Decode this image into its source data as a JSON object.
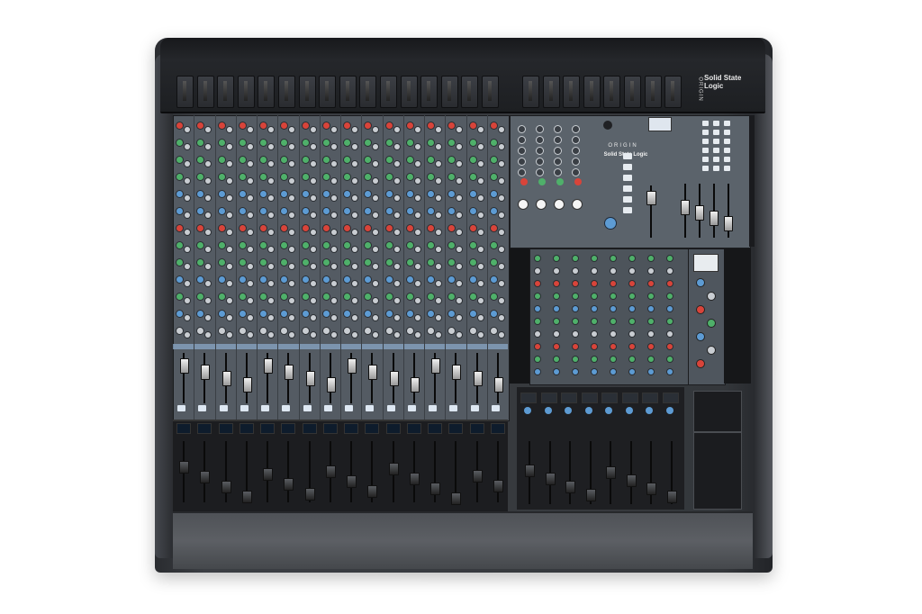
{
  "product": {
    "brand_logo_text": "Solid State Logic",
    "model_tag": "ORIGIN"
  },
  "panel": {
    "master_label": "ORIGIN",
    "master_brand": "Solid State Logic"
  },
  "colors": {
    "knob_red": "#d8443a",
    "knob_green": "#4fb06a",
    "knob_blue": "#5d9bd3",
    "knob_grey": "#c9cdd2",
    "panel_grey": "#545b63",
    "console_black": "#1c1d20"
  },
  "layout_counts_note": "",
  "icons": [
    "fader-cap",
    "rotary-knob",
    "vu-meter",
    "button"
  ]
}
